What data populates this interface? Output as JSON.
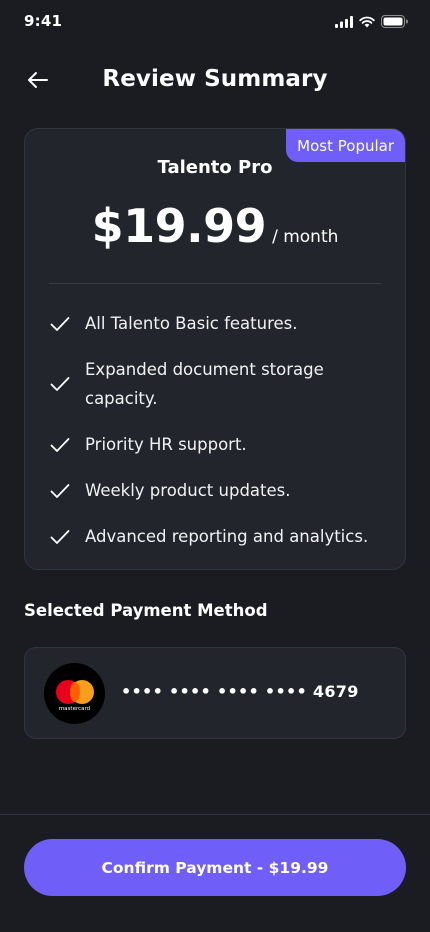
{
  "status_bar": {
    "time": "9:41"
  },
  "header": {
    "title": "Review Summary",
    "back_icon": "arrow-left-icon"
  },
  "plan": {
    "badge": "Most Popular",
    "name": "Talento Pro",
    "price": "$19.99",
    "period": "/ month",
    "features": [
      "All Talento Basic features.",
      "Expanded document storage capacity.",
      "Priority HR support.",
      "Weekly product updates.",
      "Advanced reporting and analytics."
    ]
  },
  "payment": {
    "section_title": "Selected Payment Method",
    "card_brand": "mastercard",
    "card_number": "•••• •••• •••• •••• 4679"
  },
  "footer": {
    "confirm_label": "Confirm Payment - $19.99"
  },
  "colors": {
    "background": "#1b1c22",
    "card": "#23252d",
    "accent": "#6f5ef7"
  }
}
